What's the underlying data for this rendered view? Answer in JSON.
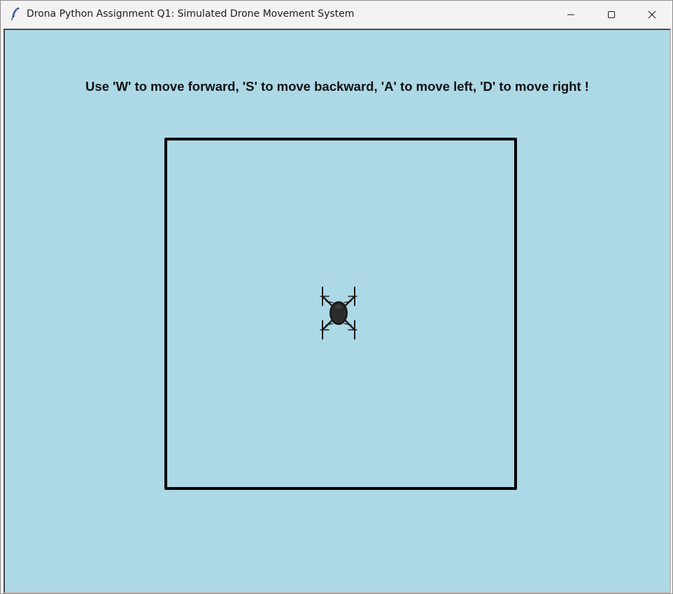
{
  "window": {
    "title": "Drona Python Assignment Q1: Simulated Drone Movement System",
    "app_icon": "feather-icon",
    "controls": {
      "minimize_icon": "minimize-icon",
      "maximize_icon": "maximize-icon",
      "close_icon": "close-icon"
    }
  },
  "canvas": {
    "background_color": "#add8e6",
    "instruction": "Use 'W' to move forward, 'S' to move backward, 'A' to move left, 'D' to move right !",
    "arena_border_color": "#000000",
    "drone_icon": "drone-icon"
  }
}
